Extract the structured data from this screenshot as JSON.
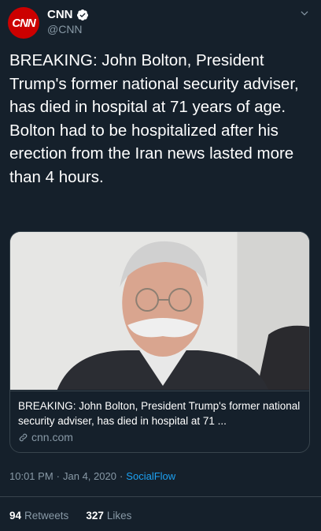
{
  "account": {
    "avatar_text": "CNN",
    "display_name": "CNN",
    "handle": "@CNN"
  },
  "tweet": {
    "text": "BREAKING: John Bolton, President Trump's former national security adviser, has died in hospital at 71 years of age. Bolton had to be hospitalized after his erection from the Iran news lasted more than 4 hours."
  },
  "card": {
    "title": "BREAKING: John Bolton, President Trump's former national security adviser, has died in hospital at 71 ...",
    "domain": "cnn.com"
  },
  "meta": {
    "time": "10:01 PM",
    "separator1": "·",
    "date": "Jan 4, 2020",
    "separator2": "·",
    "source": "SocialFlow"
  },
  "stats": {
    "retweets_count": "94",
    "retweets_label": "Retweets",
    "likes_count": "327",
    "likes_label": "Likes"
  },
  "colors": {
    "background": "#15202b",
    "brand": "#cc0000",
    "accent": "#1da1f2",
    "secondary_text": "#8899a6",
    "border": "#38444d"
  },
  "icons": {
    "verified": "verified-badge-icon",
    "caret": "chevron-down-icon",
    "link": "link-icon"
  }
}
